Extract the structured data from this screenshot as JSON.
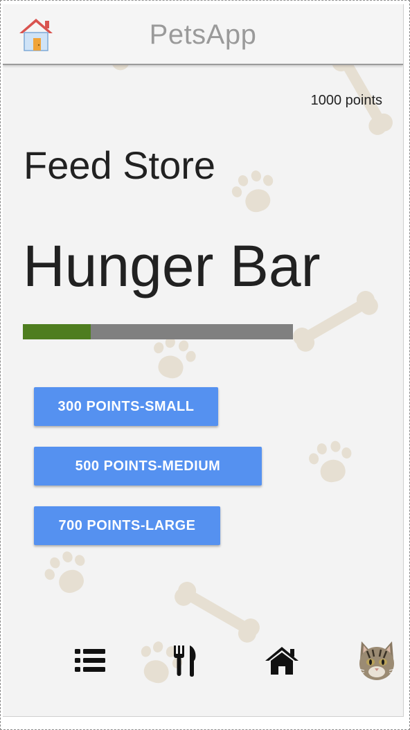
{
  "header": {
    "app_title": "PetsApp",
    "home_icon": "house-icon"
  },
  "points": {
    "label": "1000 points"
  },
  "store": {
    "title": "Feed Store"
  },
  "hunger": {
    "title": "Hunger Bar",
    "level_fraction": 0.25,
    "fill_color": "#4e7d1f",
    "track_color": "#808080"
  },
  "buttons": {
    "small": "300 POINTS-SMALL",
    "medium": "500 POINTS-MEDIUM",
    "large": "700 POINTS-LARGE",
    "color": "#5591f0"
  },
  "nav": {
    "items": [
      {
        "icon": "list-icon"
      },
      {
        "icon": "fork-knife-icon"
      },
      {
        "icon": "home-icon"
      },
      {
        "icon": "cat-avatar-icon"
      }
    ]
  }
}
